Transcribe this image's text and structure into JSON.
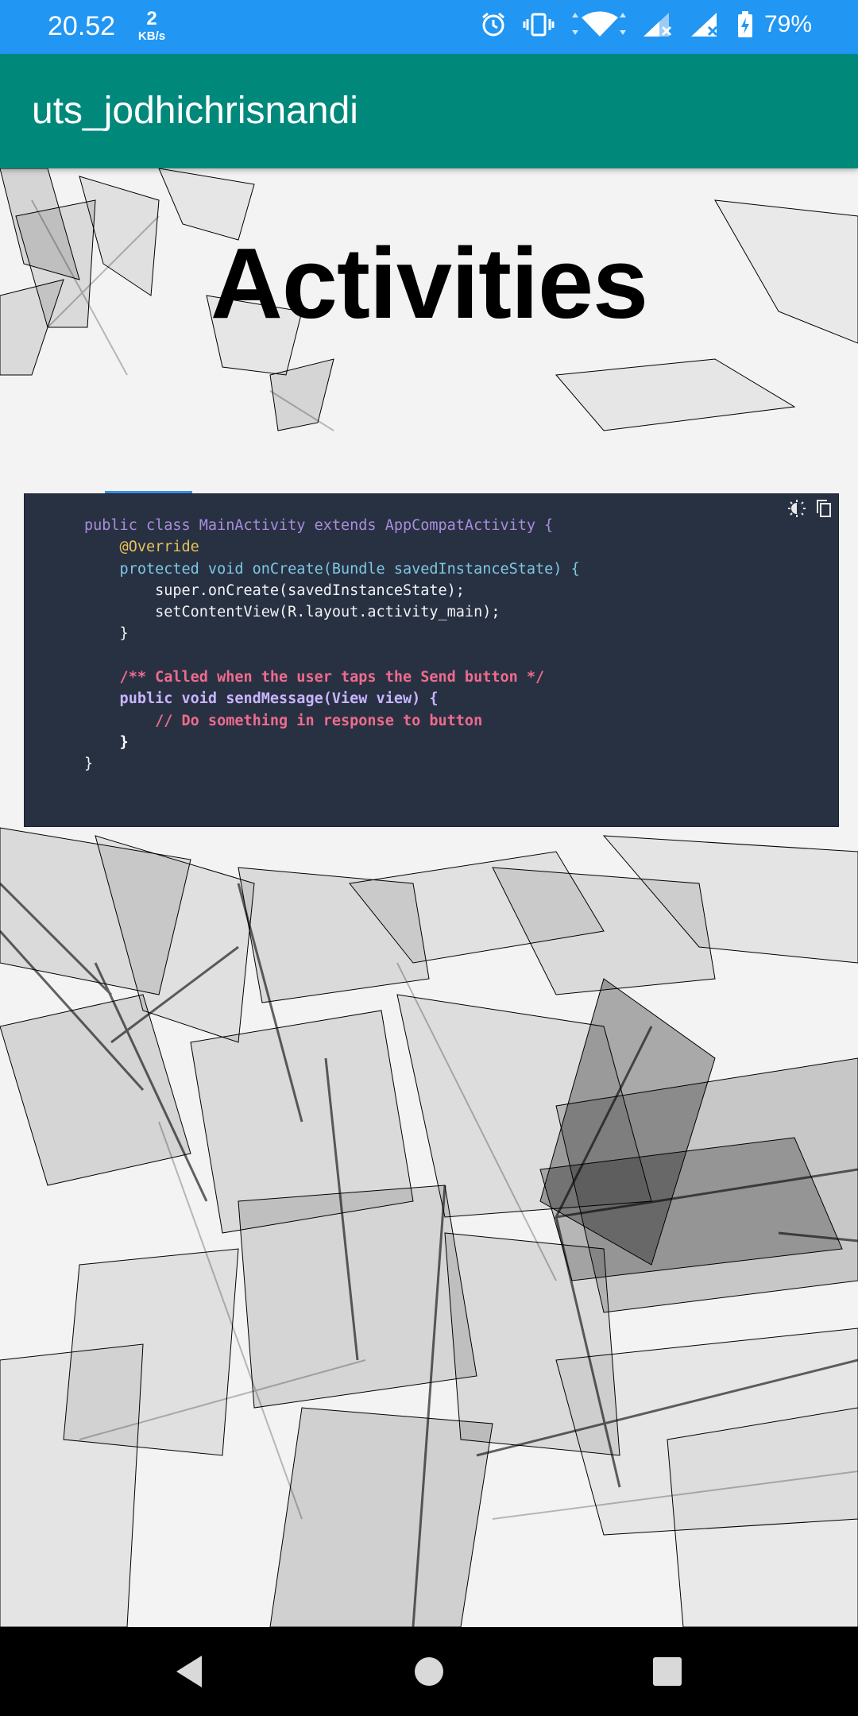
{
  "status_bar": {
    "time": "20.52",
    "speed_value": "2",
    "speed_unit": "KB/s",
    "battery": "79%",
    "icons": [
      "alarm-icon",
      "vibrate-icon",
      "wifi-icon",
      "signal-no-sim-icon",
      "signal-icon",
      "battery-charging-icon"
    ]
  },
  "app_bar": {
    "title": "uts_jodhichrisnandi"
  },
  "page": {
    "heading": "Activities"
  },
  "code_image": {
    "lines": [
      "public class MainActivity extends AppCompatActivity {",
      "    @Override",
      "    protected void onCreate(Bundle savedInstanceState) {",
      "        super.onCreate(savedInstanceState);",
      "        setContentView(R.layout.activity_main);",
      "    }",
      "",
      "    /** Called when the user taps the Send button */",
      "    public void sendMessage(View view) {",
      "        // Do something in response to button",
      "    }",
      "}"
    ],
    "tool_icons": [
      "theme-toggle-icon",
      "copy-icon"
    ]
  },
  "nav_bar": {
    "buttons": [
      "back-icon",
      "home-icon",
      "recents-icon"
    ]
  },
  "colors": {
    "status_bar": "#2196F3",
    "app_bar": "#00897B",
    "code_bg": "#283142",
    "nav_bar": "#000000"
  }
}
